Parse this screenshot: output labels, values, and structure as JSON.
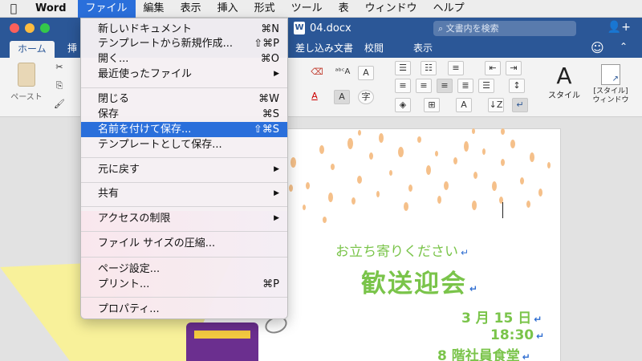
{
  "menubar": {
    "apple": "",
    "app": "Word",
    "items": [
      "ファイル",
      "編集",
      "表示",
      "挿入",
      "形式",
      "ツール",
      "表",
      "ウィンドウ",
      "ヘルプ"
    ]
  },
  "titlebar": {
    "doc_title": "04.docx",
    "doc_icon": "W",
    "search_placeholder": "文書内を検索"
  },
  "tabs": [
    "ホーム",
    "挿",
    "差し込み文書",
    "校閲",
    "表示"
  ],
  "ribbon": {
    "paste_label": "ペースト",
    "style_label": "スタイル",
    "style_window_label_1": "[スタイル]",
    "style_window_label_2": "ウィンドウ"
  },
  "file_menu": {
    "items": [
      {
        "label": "新しいドキュメント",
        "shortcut": "⌘N"
      },
      {
        "label": "テンプレートから新規作成...",
        "shortcut": "⇧⌘P"
      },
      {
        "label": "開く...",
        "shortcut": "⌘O"
      },
      {
        "label": "最近使ったファイル",
        "shortcut": "▶"
      },
      {
        "label": "閉じる",
        "shortcut": "⌘W"
      },
      {
        "label": "保存",
        "shortcut": "⌘S"
      },
      {
        "label": "名前を付けて保存...",
        "shortcut": "⇧⌘S"
      },
      {
        "label": "テンプレートとして保存...",
        "shortcut": ""
      },
      {
        "label": "元に戻す",
        "shortcut": "▶"
      },
      {
        "label": "共有",
        "shortcut": "▶"
      },
      {
        "label": "アクセスの制限",
        "shortcut": "▶"
      },
      {
        "label": "ファイル サイズの圧縮...",
        "shortcut": ""
      },
      {
        "label": "ページ設定...",
        "shortcut": ""
      },
      {
        "label": "プリント...",
        "shortcut": "⌘P"
      },
      {
        "label": "プロパティ...",
        "shortcut": ""
      }
    ],
    "highlighted": "名前を付けて保存..."
  },
  "document": {
    "greeting": "お立ち寄りください",
    "title": "歓送迎会",
    "date": "3 月 15 日",
    "time": "18:30",
    "place": "8 階社員食堂",
    "para_mark": "↵"
  },
  "colors": {
    "titlebar": "#2b5797",
    "menu_highlight": "#2a6fdb",
    "doc_text": "#7ac44a",
    "dots": "#f5c08a"
  }
}
